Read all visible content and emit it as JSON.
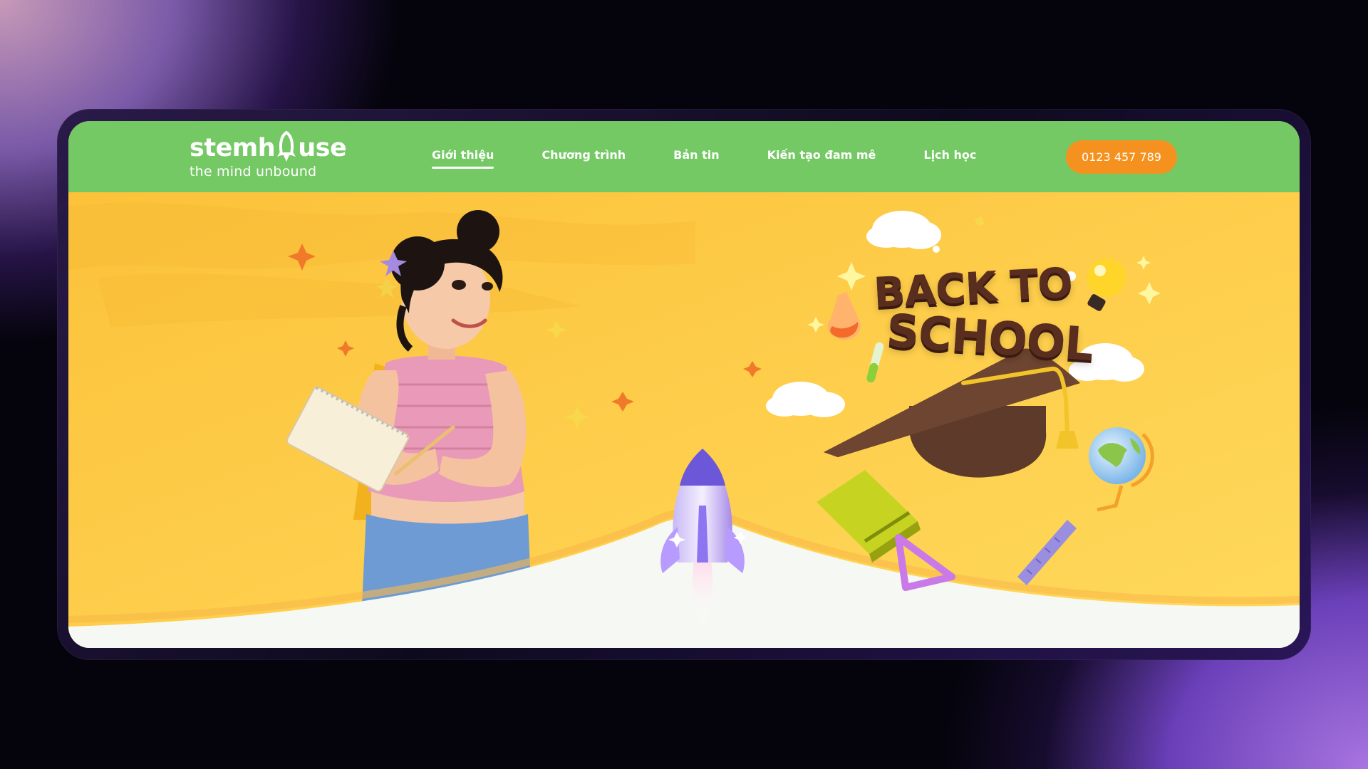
{
  "brand": {
    "name": "stemhouse",
    "name_part1": "stemh",
    "name_part2": "use",
    "tagline": "the mind unbound"
  },
  "nav": {
    "items": [
      {
        "label": "Giới thiệu",
        "active": true
      },
      {
        "label": "Chương trình",
        "active": false
      },
      {
        "label": "Bản tin",
        "active": false
      },
      {
        "label": "Kiến tạo đam mê",
        "active": false
      },
      {
        "label": "Lịch học",
        "active": false
      }
    ]
  },
  "contact": {
    "phone": "0123 457 789"
  },
  "hero": {
    "headline_line1": "BACK TO",
    "headline_line2": "SCHOOL"
  },
  "colors": {
    "header_green": "#74c964",
    "hero_yellow": "#fbc940",
    "cta_orange": "#f5921f",
    "headline_brown": "#5a2e1e"
  },
  "icons": [
    "rocket-icon",
    "graduation-cap-icon",
    "light-bulb-icon",
    "globe-icon",
    "book-icon",
    "ruler-icon",
    "triangle-ruler-icon",
    "flask-icon",
    "test-tube-icon",
    "cloud-icon",
    "sparkle-icon"
  ]
}
